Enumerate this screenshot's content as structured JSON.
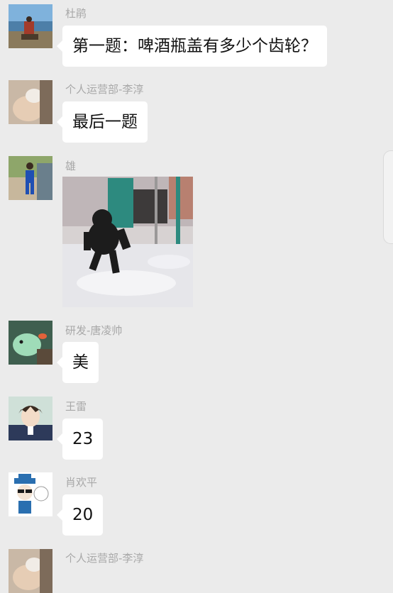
{
  "messages": [
    {
      "sender": "杜鹃",
      "text": "第一题：啤酒瓶盖有多少个齿轮？",
      "avatar": "landscape-rider-avatar"
    },
    {
      "sender": "个人运营部-李淳",
      "text": "最后一题",
      "avatar": "hand-pet-avatar"
    },
    {
      "sender": "雄",
      "sticker": "gorilla-dancing-sticker",
      "avatar": "blue-suit-man-avatar"
    },
    {
      "sender": "研发-唐凌帅",
      "text": "美",
      "avatar": "green-bird-avatar"
    },
    {
      "sender": "王雷",
      "text": "23",
      "avatar": "anime-boy-avatar"
    },
    {
      "sender": "肖欢平",
      "text": "20",
      "avatar": "cartoon-hat-avatar"
    },
    {
      "sender": "个人运营部-李淳",
      "avatar": "hand-pet-avatar"
    }
  ],
  "colors": {
    "background": "#ebebeb",
    "bubble": "#ffffff",
    "sender_name": "#a8a8a8"
  }
}
